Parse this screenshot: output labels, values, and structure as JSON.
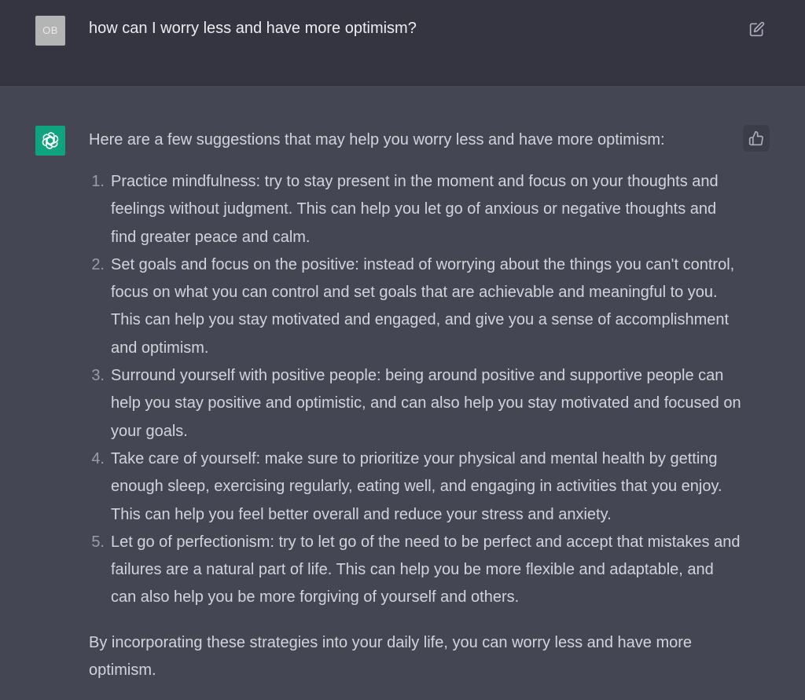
{
  "user_message": {
    "avatar_initials": "OB",
    "text": "how can I worry less and have more optimism?"
  },
  "assistant_message": {
    "intro": "Here are a few suggestions that may help you worry less and have more optimism:",
    "items": [
      {
        "number": "1.",
        "text": "Practice mindfulness: try to stay present in the moment and focus on your thoughts and feelings without judgment. This can help you let go of anxious or negative thoughts and find greater peace and calm."
      },
      {
        "number": "2.",
        "text": "Set goals and focus on the positive: instead of worrying about the things you can't control, focus on what you can control and set goals that are achievable and meaningful to you. This can help you stay motivated and engaged, and give you a sense of accomplishment and optimism."
      },
      {
        "number": "3.",
        "text": "Surround yourself with positive people: being around positive and supportive people can help you stay positive and optimistic, and can also help you stay motivated and focused on your goals."
      },
      {
        "number": "4.",
        "text": "Take care of yourself: make sure to prioritize your physical and mental health by getting enough sleep, exercising regularly, eating well, and engaging in activities that you enjoy. This can help you feel better overall and reduce your stress and anxiety."
      },
      {
        "number": "5.",
        "text": "Let go of perfectionism: try to let go of the need to be perfect and accept that mistakes and failures are a natural part of life. This can help you be more flexible and adaptable, and can also help you be more forgiving of yourself and others."
      }
    ],
    "outro": "By incorporating these strategies into your daily life, you can worry less and have more optimism."
  },
  "icons": {
    "edit": "edit-icon",
    "assistant_logo": "openai-logo-icon",
    "thumbs_up": "thumbs-up-icon"
  },
  "colors": {
    "user_bg": "#343541",
    "assistant_bg": "#444654",
    "assistant_avatar": "#10a37f",
    "user_avatar": "#b4b4b4",
    "text": "#d1d5db"
  }
}
